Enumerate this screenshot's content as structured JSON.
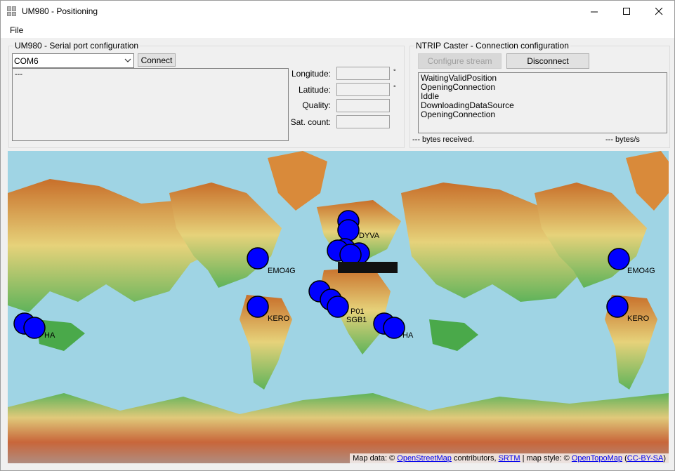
{
  "window": {
    "title": "UM980 - Positioning"
  },
  "menu": {
    "file": "File"
  },
  "serial": {
    "group_title": "UM980 - Serial port configuration",
    "port": "COM6",
    "connect_label": "Connect",
    "log_text": "---",
    "longitude_label": "Longitude:",
    "latitude_label": "Latitude:",
    "quality_label": "Quality:",
    "sat_count_label": "Sat. count:",
    "degree_symbol": "°"
  },
  "ntrip": {
    "group_title": "NTRIP Caster - Connection configuration",
    "configure_stream_label": "Configure stream",
    "disconnect_label": "Disconnect",
    "status_lines": [
      "WaitingValidPosition",
      "OpeningConnection",
      "Iddle",
      "DownloadingDataSource",
      "OpeningConnection"
    ],
    "bytes_received": "--- bytes received.",
    "bytes_rate": "--- bytes/s"
  },
  "map": {
    "attribution": {
      "prefix": "Map data: © ",
      "osm": "OpenStreetMap",
      "contributors": " contributors, ",
      "srtm": "SRTM",
      "style": " | map style: © ",
      "opentopomap": "OpenTopoMap",
      "open_paren": " (",
      "license": "CC-BY-SA",
      "close_paren": ")"
    },
    "station_labels": [
      "EMO4G",
      "KERO",
      "EMO4G",
      "KERO",
      "SGB1",
      "P01",
      "DYVA",
      "HA",
      "HA"
    ],
    "colors": {
      "ocean": "#9fd4e4",
      "marker": "#0000ff",
      "land_low": "#5fb35a",
      "land_high": "#c86f2a"
    }
  }
}
